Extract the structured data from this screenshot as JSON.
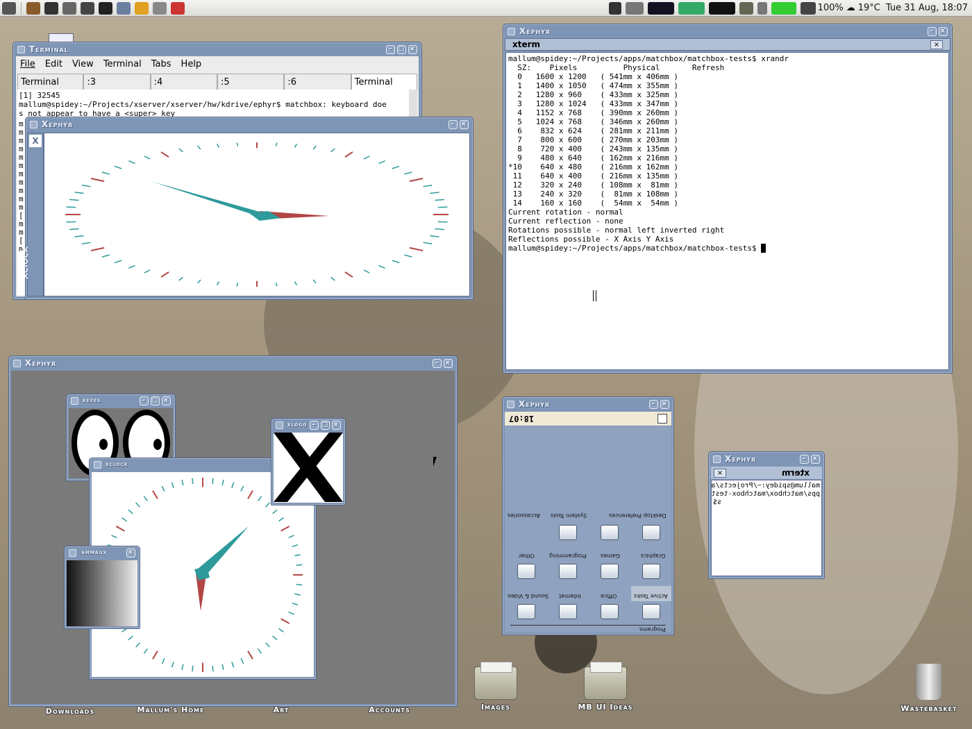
{
  "panel": {
    "battery": "100%",
    "weather": "19°C",
    "datetime": "Tue 31 Aug, 18:07"
  },
  "terminal_win": {
    "title": "Terminal",
    "menu": [
      "File",
      "Edit",
      "View",
      "Terminal",
      "Tabs",
      "Help"
    ],
    "tabs": [
      "Terminal",
      ":3",
      ":4",
      ":5",
      ":6",
      "Terminal"
    ],
    "lines": [
      "[1] 32545",
      "mallum@spidey:~/Projects/xserver/xserver/hw/kdrive/ephyr$ matchbox: keyboard doe",
      "s not appear to have a <super> key"
    ],
    "side_chars": [
      "m",
      "m",
      "m",
      "m",
      "m",
      "m",
      "m",
      "m",
      "m",
      "m",
      "m",
      "[",
      "m",
      "m",
      "[",
      "m"
    ]
  },
  "xephyr_clock_win": {
    "title": "Xephyr",
    "app_label": "xclock"
  },
  "xephyr_xterm_win": {
    "title": "Xephyr",
    "tab": "xterm",
    "lines": [
      "mallum@spidey:~/Projects/apps/matchbox/matchbox-tests$ xrandr",
      "  SZ:    Pixels          Physical       Refresh",
      "  0   1600 x 1200   ( 541mm x 406mm )",
      "  1   1400 x 1050   ( 474mm x 355mm )",
      "  2   1280 x 960    ( 433mm x 325mm )",
      "  3   1280 x 1024   ( 433mm x 347mm )",
      "  4   1152 x 768    ( 390mm x 260mm )",
      "  5   1024 x 768    ( 346mm x 260mm )",
      "  6    832 x 624    ( 281mm x 211mm )",
      "  7    800 x 600    ( 270mm x 203mm )",
      "  8    720 x 400    ( 243mm x 135mm )",
      "  9    480 x 640    ( 162mm x 216mm )",
      "*10    640 x 480    ( 216mm x 162mm )",
      " 11    640 x 400    ( 216mm x 135mm )",
      " 12    320 x 240    ( 108mm x  81mm )",
      " 13    240 x 320    (  81mm x 108mm )",
      " 14    160 x 160    (  54mm x  54mm )",
      "Current rotation - normal",
      "Current reflection - none",
      "Rotations possible - normal left inverted right",
      "Reflections possible - X Axis Y Axis",
      "mallum@spidey:~/Projects/apps/matchbox/matchbox-tests$ "
    ]
  },
  "xephyr_desktop_win": {
    "title": "Xephyr",
    "xeyes_title": "xeyes",
    "xlogo_title": "xlogo",
    "xclock_title": "xclock",
    "xgamma_title": "xgamma"
  },
  "xephyr_menu_win": {
    "title": "Xephyr",
    "time": "18:07",
    "rows": [
      [
        "Accessories",
        "System Tools",
        "Desktop Preferences"
      ],
      [
        "Graphics",
        "Games",
        "Programming",
        "Other"
      ],
      [
        "Active Tasks",
        "Office",
        "Internet",
        "Sound & Video"
      ]
    ],
    "section": "Programs"
  },
  "xephyr_small_win": {
    "title": "Xephyr",
    "tab": "xterm",
    "lines": [
      "mallum@spidey:~/Projects/a",
      "pps/matchbox/matchbox-test",
      "s$"
    ]
  },
  "desktop_icons": [
    "Downloads",
    "Mallum's Home",
    "Art",
    "Accounts",
    "Images",
    "MB UI Ideas",
    "Wastebasket"
  ]
}
